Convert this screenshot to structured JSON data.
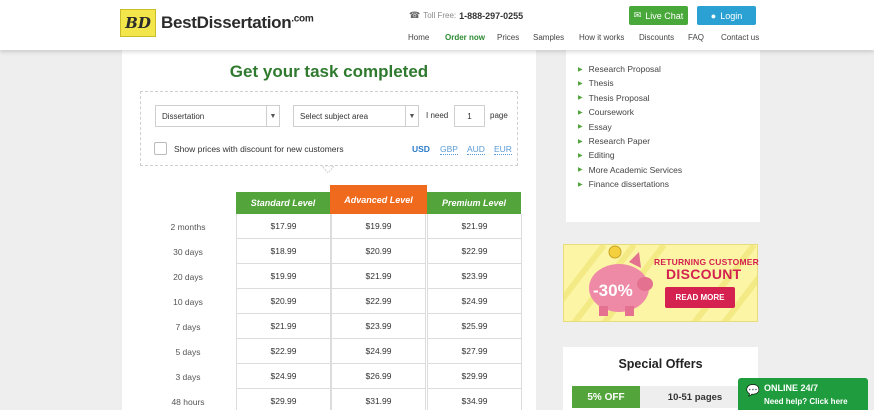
{
  "header": {
    "logo_mark": "BD",
    "logo_text": "BestDissertation",
    "logo_suffix": ".com",
    "phone_label": "Toll Free:",
    "phone_number": "1-888-297-0255",
    "chat_label": "Live Chat",
    "login_label": "Login",
    "nav": [
      "Home",
      "Order now",
      "Prices",
      "Samples",
      "How it works",
      "Discounts",
      "FAQ",
      "Contact us"
    ],
    "active_nav": "Order now",
    "accent_green": "#48a83a",
    "accent_blue": "#2aa1d2"
  },
  "order_form": {
    "title": "Get your task completed",
    "doc_type": "Dissertation",
    "subject": "Select subject area",
    "i_need": "I need",
    "pages": "1",
    "page_label": "page",
    "discount_checkbox_label": "Show prices with discount for new customers",
    "currencies": [
      "USD",
      "GBP",
      "AUD",
      "EUR"
    ],
    "active_currency": "USD"
  },
  "price_table": {
    "levels": [
      "Standard Level",
      "Advanced Level",
      "Premium Level"
    ],
    "highlighted_level": "Advanced Level",
    "rows": [
      {
        "deadline": "2 months",
        "prices": [
          "$17.99",
          "$19.99",
          "$21.99"
        ]
      },
      {
        "deadline": "30 days",
        "prices": [
          "$18.99",
          "$20.99",
          "$22.99"
        ]
      },
      {
        "deadline": "20 days",
        "prices": [
          "$19.99",
          "$21.99",
          "$23.99"
        ]
      },
      {
        "deadline": "10 days",
        "prices": [
          "$20.99",
          "$22.99",
          "$24.99"
        ]
      },
      {
        "deadline": "7 days",
        "prices": [
          "$21.99",
          "$23.99",
          "$25.99"
        ]
      },
      {
        "deadline": "5 days",
        "prices": [
          "$22.99",
          "$24.99",
          "$27.99"
        ]
      },
      {
        "deadline": "3 days",
        "prices": [
          "$24.99",
          "$26.99",
          "$29.99"
        ]
      },
      {
        "deadline": "48 hours",
        "prices": [
          "$29.99",
          "$31.99",
          "$34.99"
        ]
      }
    ]
  },
  "sidebar": {
    "services": [
      "Research Proposal",
      "Thesis",
      "Thesis Proposal",
      "Coursework",
      "Essay",
      "Research Paper",
      "Editing",
      "More Academic Services",
      "Finance dissertations"
    ]
  },
  "discount_banner": {
    "percent": "-30%",
    "line1": "RETURNING CUSTOMER",
    "line2": "DISCOUNT",
    "button": "READ MORE"
  },
  "special_offers": {
    "title": "Special Offers",
    "badge": "5% OFF",
    "pages": "10-51 pages"
  },
  "online_widget": {
    "title": "ONLINE 24/7",
    "subtitle": "Need help? Click here"
  }
}
